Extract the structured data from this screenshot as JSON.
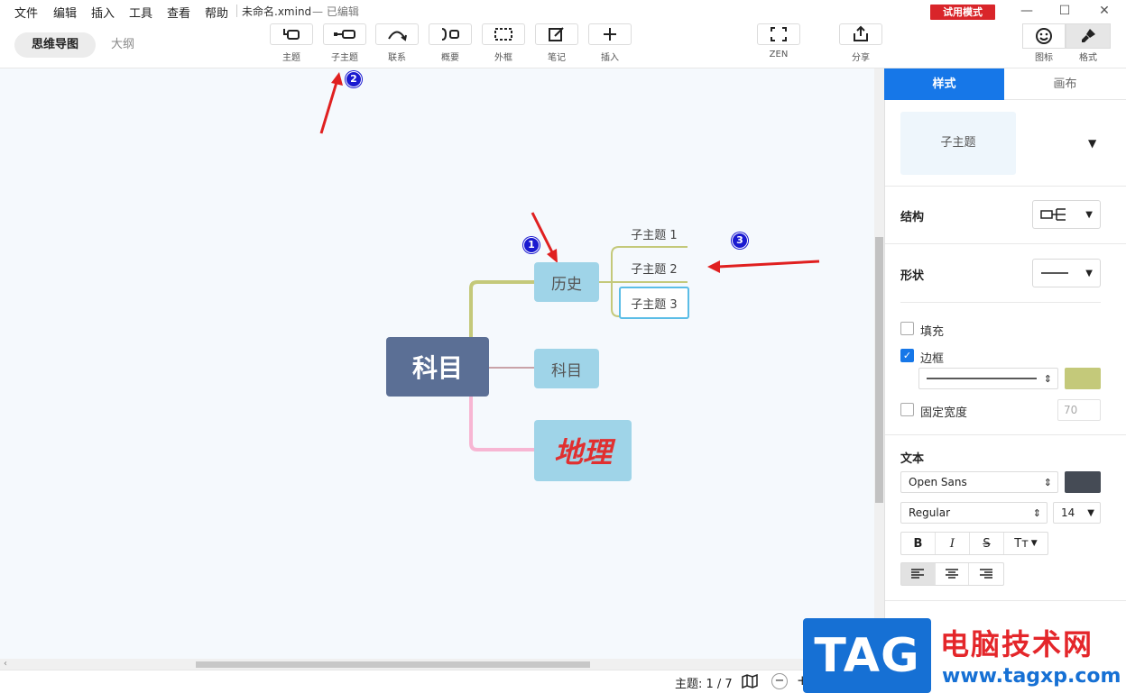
{
  "menu": {
    "items": [
      "文件",
      "编辑",
      "插入",
      "工具",
      "查看",
      "帮助"
    ],
    "doc_name": "未命名.xmind",
    "doc_status": "— 已编辑",
    "trial_badge": "试用模式"
  },
  "window": {
    "minimize": "—",
    "maximize": "☐",
    "close": "✕"
  },
  "view_tabs": {
    "mindmap": "思维导图",
    "outline": "大纲"
  },
  "toolbar": {
    "topic": "主题",
    "subtopic": "子主题",
    "relationship": "联系",
    "summary": "概要",
    "boundary": "外框",
    "note": "笔记",
    "insert": "插入",
    "zen": "ZEN",
    "share": "分享",
    "icons": "图标",
    "format": "格式"
  },
  "mindmap": {
    "central": "科目",
    "main_topics": [
      "历史",
      "科目",
      "地理"
    ],
    "subtopics": [
      "子主题 1",
      "子主题 2",
      "子主题 3"
    ]
  },
  "annotations": [
    "1",
    "2",
    "3"
  ],
  "panel": {
    "tabs": {
      "style": "样式",
      "canvas": "画布"
    },
    "preview_label": "子主题",
    "structure_label": "结构",
    "shape_label": "形状",
    "fill_label": "填充",
    "border_label": "边框",
    "border_color": "#c4c97a",
    "fixed_width_label": "固定宽度",
    "fixed_width_value": "70",
    "text_label": "文本",
    "font_family": "Open Sans",
    "font_color": "#454b55",
    "font_weight": "Regular",
    "font_size": "14",
    "bold": "B",
    "italic": "I",
    "strike": "S",
    "case": "Tт"
  },
  "status": {
    "topic_count": "主题: 1 / 7",
    "zoom_out": "−",
    "zoom_in": "+"
  },
  "watermark": {
    "tag": "TAG",
    "title": "电脑技术网",
    "url": "www.tagxp.com"
  },
  "colors": {
    "accent": "#1677e8",
    "central_topic": "#5b6f95",
    "main_topic": "#9fd4e8",
    "branch_history": "#c4c97a",
    "branch_subject": "#c9a3a8",
    "branch_geo": "#f7b6d3",
    "trial_badge": "#d9252a"
  }
}
